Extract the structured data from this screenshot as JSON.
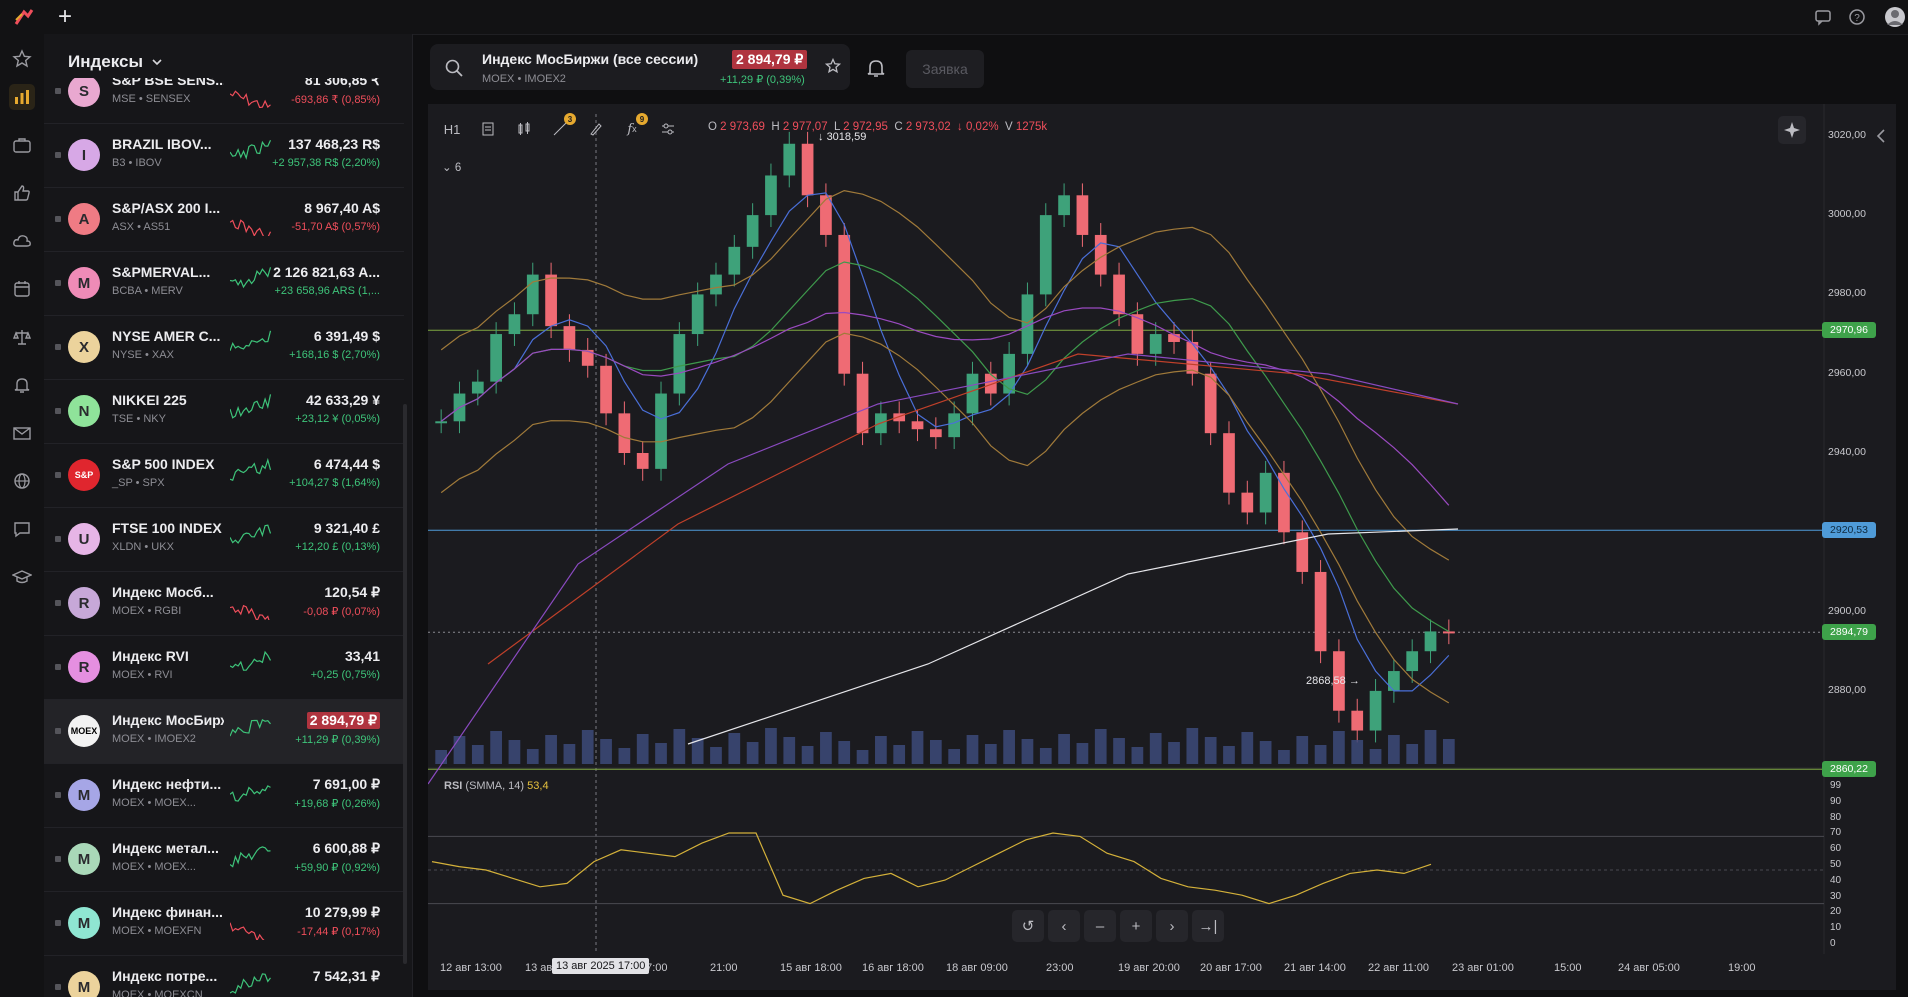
{
  "topbar": {
    "plus_label": "+",
    "icons": [
      "chat-icon",
      "help-icon",
      "avatar-icon"
    ]
  },
  "rail": {
    "icons": [
      "star-icon",
      "bar-chart-icon",
      "briefcase-icon",
      "thumbs-up-icon",
      "cloud-icon",
      "calendar-icon",
      "scales-icon",
      "bell-icon",
      "mail-icon",
      "globe-icon",
      "chat-icon",
      "graduation-icon"
    ],
    "active_index": 1
  },
  "watchlist": {
    "title": "Индексы",
    "rows": [
      {
        "name": "S&P BSE SENS...",
        "sub": "MSE • SENSEX",
        "price": "81 306,85 ₹",
        "change": "-693,86 ₹ (0,85%)",
        "dir": "neg",
        "avatar": "S",
        "color": "#e9a8d0"
      },
      {
        "name": "BRAZIL IBOV...",
        "sub": "B3 • IBOV",
        "price": "137 468,23 R$",
        "change": "+2 957,38 R$ (2,20%)",
        "dir": "pos",
        "avatar": "I",
        "color": "#d7a8e6"
      },
      {
        "name": "S&P/ASX 200 I...",
        "sub": "ASX • AS51",
        "price": "8 967,40 A$",
        "change": "-51,70 A$ (0,57%)",
        "dir": "neg",
        "avatar": "A",
        "color": "#ef7b84"
      },
      {
        "name": "S&PMERVAL...",
        "sub": "BCBA • MERV",
        "price": "2 126 821,63 A...",
        "change": "+23 658,96 ARS (1,...",
        "dir": "pos",
        "avatar": "M",
        "color": "#ef8bb7"
      },
      {
        "name": "NYSE AMER C...",
        "sub": "NYSE • XAX",
        "price": "6 391,49 $",
        "change": "+168,16 $ (2,70%)",
        "dir": "pos",
        "avatar": "X",
        "color": "#ecd39c"
      },
      {
        "name": "NIKKEI 225",
        "sub": "TSE • NKY",
        "price": "42 633,29 ¥",
        "change": "+23,12 ¥ (0,05%)",
        "dir": "pos",
        "avatar": "N",
        "color": "#8fe39a"
      },
      {
        "name": "S&P 500 INDEX",
        "sub": "_SP • SPX",
        "price": "6 474,44 $",
        "change": "+104,27 $ (1,64%)",
        "dir": "pos",
        "avatar": "S&P",
        "color": "#e0262e"
      },
      {
        "name": "FTSE 100 INDEX",
        "sub": "XLDN • UKX",
        "price": "9 321,40 £",
        "change": "+12,20 £ (0,13%)",
        "dir": "pos",
        "avatar": "U",
        "color": "#e6b5e6"
      },
      {
        "name": "Индекс Мосб...",
        "sub": "MOEX • RGBI",
        "price": "120,54 ₽",
        "change": "-0,08 ₽ (0,07%)",
        "dir": "neg",
        "avatar": "R",
        "color": "#c7a8d8"
      },
      {
        "name": "Индекс RVI",
        "sub": "MOEX • RVI",
        "price": "33,41",
        "change": "+0,25 (0,75%)",
        "dir": "pos",
        "avatar": "R",
        "color": "#e58fe0"
      },
      {
        "name": "Индекс МосБиржи ...",
        "sub": "MOEX • IMOEX2",
        "price": "2 894,79 ₽",
        "change": "+11,29 ₽ (0,39%)",
        "dir": "pos",
        "avatar": "MOEX",
        "color": "#f2f2f2",
        "selected": true
      },
      {
        "name": "Индекс нефти...",
        "sub": "MOEX • MOEX...",
        "price": "7 691,00 ₽",
        "change": "+19,68 ₽ (0,26%)",
        "dir": "pos",
        "avatar": "M",
        "color": "#a6a6e6"
      },
      {
        "name": "Индекс метал...",
        "sub": "MOEX • MOEX...",
        "price": "6 600,88 ₽",
        "change": "+59,90 ₽ (0,92%)",
        "dir": "pos",
        "avatar": "M",
        "color": "#a9d8b8"
      },
      {
        "name": "Индекс финан...",
        "sub": "MOEX • MOEXFN",
        "price": "10 279,99 ₽",
        "change": "-17,44 ₽ (0,17%)",
        "dir": "neg",
        "avatar": "M",
        "color": "#8fe6d2"
      },
      {
        "name": "Индекс потре...",
        "sub": "MOEX • MOEXCN",
        "price": "7 542,31 ₽",
        "change": "",
        "dir": "pos",
        "avatar": "M",
        "color": "#ecd39c"
      }
    ]
  },
  "header": {
    "title": "Индекс МосБиржи (все сессии)",
    "ticker": "MOEX • IMOEX2",
    "price": "2 894,79 ₽",
    "change": "+11,29 ₽ (0,39%)",
    "order_button": "Заявка"
  },
  "toolbar": {
    "timeframe": "H1",
    "badge_drawings": "3",
    "badge_indicators": "9"
  },
  "ohlc": {
    "o_label": "O",
    "o": "2 973,69",
    "h_label": "H",
    "h": "2 977,07",
    "l_label": "L",
    "l": "2 972,95",
    "c_label": "C",
    "c": "2 973,02",
    "pct": "0,02%",
    "v_label": "V",
    "v": "1275k"
  },
  "collapse_label": "6",
  "price_axis": {
    "ticks": [
      "3020,00",
      "3000,00",
      "2980,00",
      "2960,00",
      "2940,00",
      "2920,00",
      "2900,00",
      "2880,00",
      "2860,00"
    ],
    "labels": [
      {
        "text": "2970,96",
        "color": "#3ea24a"
      },
      {
        "text": "2920,53",
        "color": "#4f9bd8"
      },
      {
        "text": "2894,79",
        "color": "#3ea24a"
      },
      {
        "text": "2860,22",
        "color": "#3ea24a"
      }
    ]
  },
  "annotations": {
    "high": "3018,59",
    "low": "2868,58"
  },
  "time_axis": {
    "ticks": [
      "12 авг 13:00",
      "13 авг",
      "07:00",
      "21:00",
      "15 авг 18:00",
      "16 авг 18:00",
      "18 авг 09:00",
      "23:00",
      "19 авг 20:00",
      "20 авг 17:00",
      "21 авг 14:00",
      "22 авг 11:00",
      "23 авг 01:00",
      "15:00",
      "24 авг 05:00",
      "19:00"
    ],
    "crosshair": "13 авг 2025 17:00"
  },
  "rsi": {
    "name": "RSI",
    "params": "(SMMA, 14)",
    "value": "53,4",
    "ticks": [
      "99",
      "90",
      "80",
      "70",
      "60",
      "50",
      "40",
      "30",
      "20",
      "10",
      "0"
    ]
  },
  "chart_data": {
    "type": "line",
    "title": "Индекс МосБиржи (все сессии)",
    "series": [
      {
        "name": "IMOEX2",
        "values": [
          2948,
          2955,
          2958,
          2970,
          2975,
          2985,
          2972,
          2966,
          2962,
          2950,
          2940,
          2936,
          2955,
          2970,
          2980,
          2985,
          2992,
          3000,
          3010,
          3018,
          3005,
          2995,
          2960,
          2945,
          2950,
          2948,
          2946,
          2944,
          2950,
          2960,
          2955,
          2965,
          2980,
          3000,
          3005,
          2995,
          2985,
          2975,
          2965,
          2970,
          2968,
          2960,
          2945,
          2930,
          2925,
          2935,
          2920,
          2910,
          2890,
          2875,
          2870,
          2880,
          2885,
          2890,
          2895,
          2894.79
        ]
      },
      {
        "name": "RSI",
        "values": [
          55,
          52,
          50,
          45,
          40,
          42,
          55,
          62,
          60,
          58,
          66,
          72,
          72,
          35,
          30,
          38,
          45,
          48,
          40,
          44,
          52,
          60,
          68,
          72,
          70,
          60,
          55,
          45,
          40,
          38,
          35,
          30,
          35,
          42,
          48,
          50,
          48,
          53.4
        ]
      }
    ],
    "ylim": [
      2855,
      3025
    ],
    "horizontal_levels": [
      2970.96,
      2920.53,
      2860.22
    ]
  }
}
